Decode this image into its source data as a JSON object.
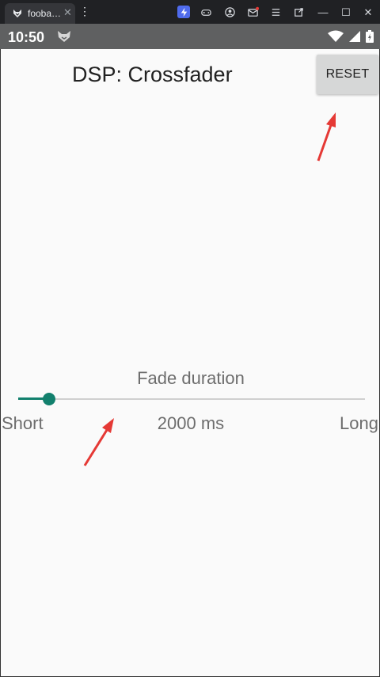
{
  "window": {
    "tab_title": "fooba…",
    "tab_close": "✕",
    "menu_glyph": "⋮",
    "minimize": "—",
    "maximize": "☐",
    "close": "✕"
  },
  "status_bar": {
    "time": "10:50"
  },
  "app": {
    "title": "DSP: Crossfader",
    "reset_label": "RESET",
    "fade": {
      "label": "Fade duration",
      "min_label": "Short",
      "max_label": "Long",
      "value_text": "2000 ms",
      "position_fraction": 0.09
    }
  },
  "colors": {
    "accent": "#12806d",
    "annotation": "#e53935"
  }
}
